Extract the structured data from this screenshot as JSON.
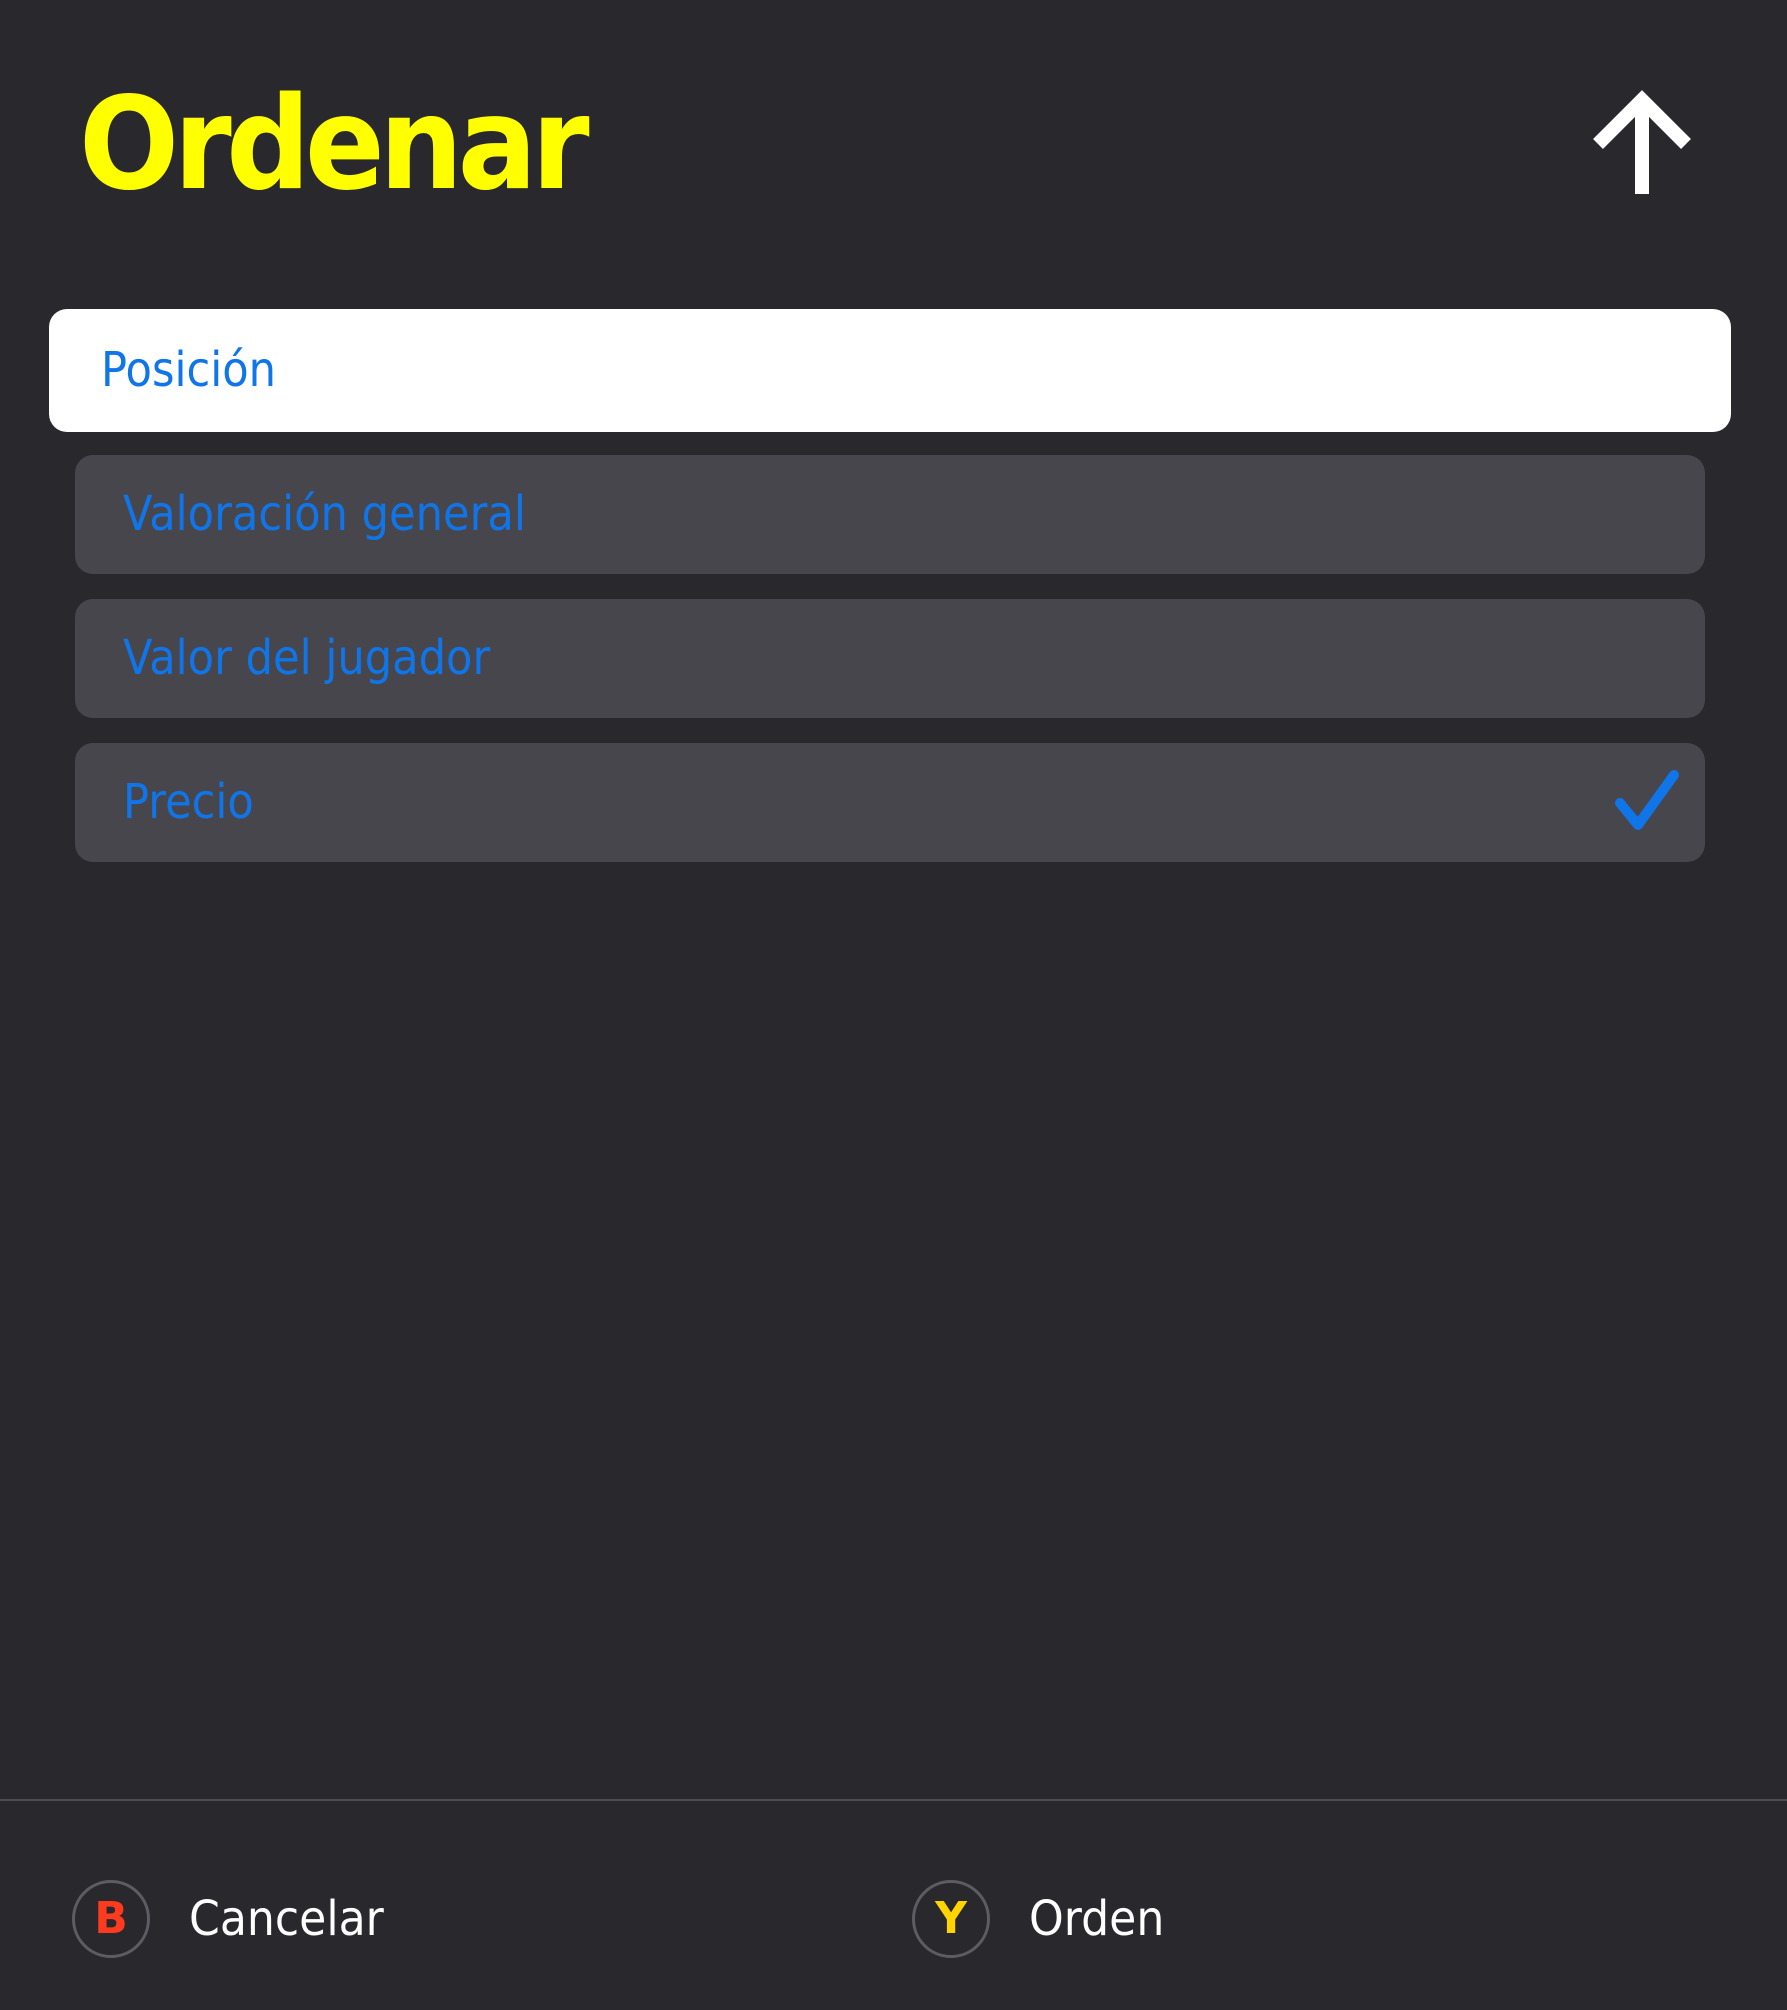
{
  "header": {
    "title": "Ordenar",
    "sort_direction_icon": "arrow-up-icon"
  },
  "options": [
    {
      "label": "Posición",
      "focused": true,
      "selected": false
    },
    {
      "label": "Valoración general",
      "focused": false,
      "selected": false
    },
    {
      "label": "Valor del jugador",
      "focused": false,
      "selected": false
    },
    {
      "label": "Precio",
      "focused": false,
      "selected": true
    }
  ],
  "footer": {
    "cancel": {
      "key": "B",
      "label": "Cancelar"
    },
    "order": {
      "key": "Y",
      "label": "Orden"
    }
  },
  "colors": {
    "background": "#28282d",
    "title": "#ffff00",
    "option_bg": "#46464c",
    "option_focused_bg": "#ffffff",
    "option_text": "#0f75e8",
    "check": "#0f75e8",
    "key_b": "#ff3b1f",
    "key_y": "#ffd400",
    "footer_text": "#ffffff"
  }
}
